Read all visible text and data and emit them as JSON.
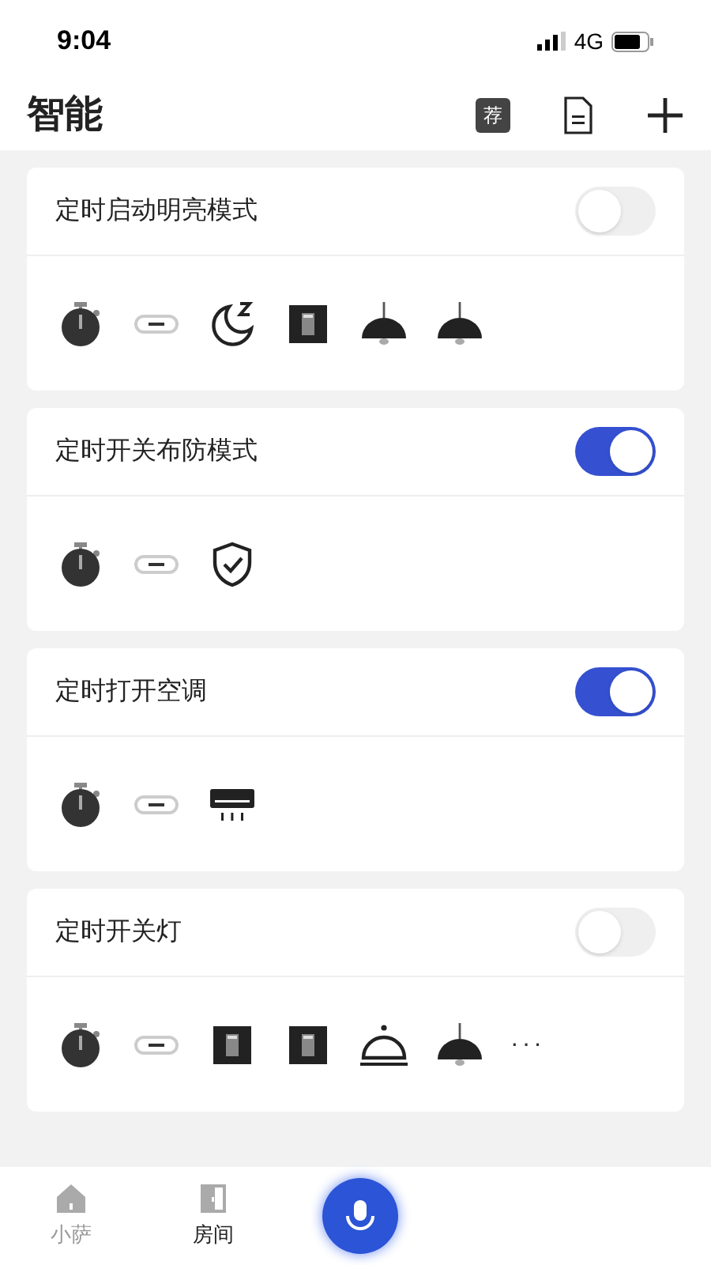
{
  "status_bar": {
    "time": "9:04",
    "network": "4G"
  },
  "header": {
    "title": "智能",
    "badge": "荐"
  },
  "scenes": [
    {
      "title": "定时启动明亮模式",
      "on": false,
      "icons": [
        {
          "kind": "timer"
        },
        {
          "kind": "link"
        },
        {
          "kind": "moon"
        },
        {
          "kind": "switch"
        },
        {
          "kind": "lamp"
        },
        {
          "kind": "lamp"
        }
      ]
    },
    {
      "title": "定时开关布防模式",
      "on": true,
      "icons": [
        {
          "kind": "timer"
        },
        {
          "kind": "link"
        },
        {
          "kind": "shield"
        }
      ]
    },
    {
      "title": "定时打开空调",
      "on": true,
      "icons": [
        {
          "kind": "timer"
        },
        {
          "kind": "link"
        },
        {
          "kind": "ac"
        }
      ]
    },
    {
      "title": "定时开关灯",
      "on": false,
      "icons": [
        {
          "kind": "timer"
        },
        {
          "kind": "link"
        },
        {
          "kind": "switch"
        },
        {
          "kind": "switch"
        },
        {
          "kind": "bell"
        },
        {
          "kind": "lamp"
        },
        {
          "kind": "more",
          "label": "···"
        }
      ]
    }
  ],
  "tab_bar": [
    {
      "kind": "home",
      "label": "小萨",
      "selected": false
    },
    {
      "kind": "room",
      "label": "房间",
      "selected": true
    },
    {
      "kind": "mic"
    }
  ]
}
